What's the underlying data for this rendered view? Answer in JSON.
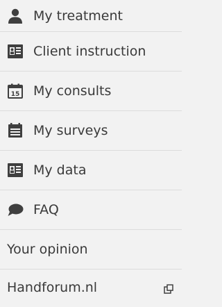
{
  "menu": {
    "items": [
      {
        "label": "My treatment",
        "icon": "person-icon"
      },
      {
        "label": "Client instruction",
        "icon": "id-card-icon"
      },
      {
        "label": "My consults",
        "icon": "calendar-icon"
      },
      {
        "label": "My surveys",
        "icon": "clipboard-icon"
      },
      {
        "label": "My data",
        "icon": "id-card-icon"
      },
      {
        "label": "FAQ",
        "icon": "speech-bubble-icon"
      },
      {
        "label": "Your opinion"
      },
      {
        "label": "Handforum.nl",
        "trailing_icon": "external-link-icon"
      }
    ],
    "calendar_day": "15"
  },
  "colors": {
    "background": "#f2f2f2",
    "text": "#3a3a3a",
    "icon": "#3f3f3f",
    "divider": "#dcdcdc"
  }
}
